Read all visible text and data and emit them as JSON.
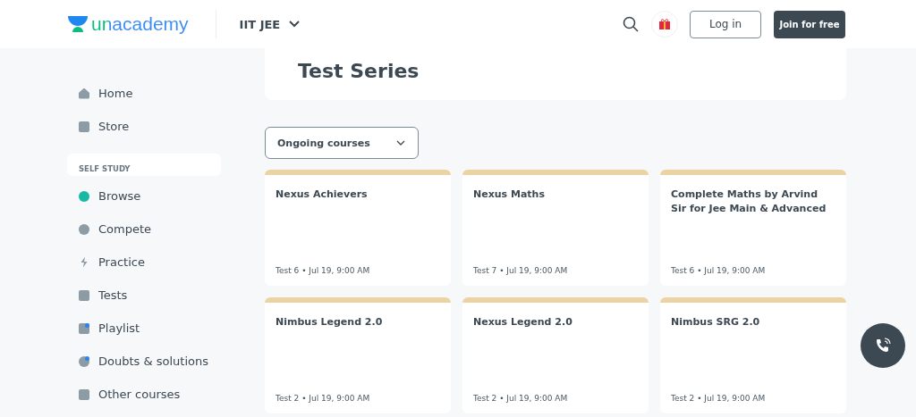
{
  "header": {
    "logo": "unacademy",
    "goal": "IIT JEE",
    "login": "Log in",
    "join": "Join for free"
  },
  "sidebar": {
    "items": [
      {
        "label": "Home",
        "badge": false
      },
      {
        "label": "Store",
        "badge": false
      }
    ],
    "section": "SELF STUDY",
    "section_items": [
      {
        "label": "Browse",
        "badge": false
      },
      {
        "label": "Compete",
        "badge": false
      },
      {
        "label": "Practice",
        "badge": false
      },
      {
        "label": "Tests",
        "badge": false
      },
      {
        "label": "Playlist",
        "badge": true
      },
      {
        "label": "Doubts & solutions",
        "badge": true
      },
      {
        "label": "Other courses",
        "badge": false
      }
    ]
  },
  "page": {
    "title": "Test Series",
    "filter": "Ongoing courses"
  },
  "cards": [
    {
      "title": "Nexus Achievers",
      "meta": "Test 6 • Jul 19, 9:00 AM"
    },
    {
      "title": "Nexus Maths",
      "meta": "Test 7 • Jul 19, 9:00 AM"
    },
    {
      "title": "Complete Maths by Arvind Sir for Jee Main & Advanced",
      "meta": "Test 6 • Jul 19, 9:00 AM"
    },
    {
      "title": "Nimbus Legend 2.0",
      "meta": "Test 2 • Jul 19, 9:00 AM"
    },
    {
      "title": "Nexus Legend 2.0",
      "meta": "Test 2 • Jul 19, 9:00 AM"
    },
    {
      "title": "Nimbus SRG 2.0",
      "meta": "Test 2 • Jul 19, 9:00 AM"
    }
  ]
}
